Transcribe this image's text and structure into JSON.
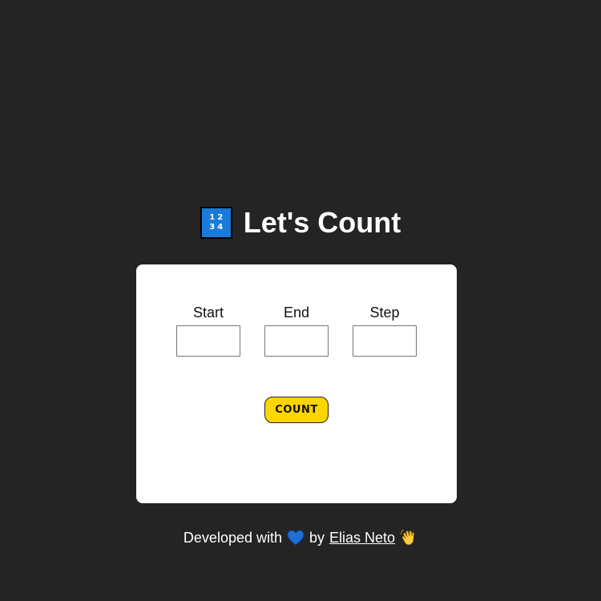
{
  "header": {
    "icon": "numbers-1234-icon",
    "icon_digits": [
      "1",
      "2",
      "3",
      "4"
    ],
    "title": "Let's Count"
  },
  "form": {
    "fields": [
      {
        "label": "Start",
        "value": "",
        "placeholder": ""
      },
      {
        "label": "End",
        "value": "",
        "placeholder": ""
      },
      {
        "label": "Step",
        "value": "",
        "placeholder": ""
      }
    ],
    "count_button": "COUNT"
  },
  "footer": {
    "prefix": "Developed with",
    "heart_icon": "blue-heart-icon",
    "by": "by",
    "author": "Elias Neto",
    "wave_icon": "waving-hand-icon"
  },
  "colors": {
    "background": "#242424",
    "card": "#ffffff",
    "button": "#ffd500",
    "heart": "#1f6fd6",
    "icon": "#1a7ad9"
  }
}
